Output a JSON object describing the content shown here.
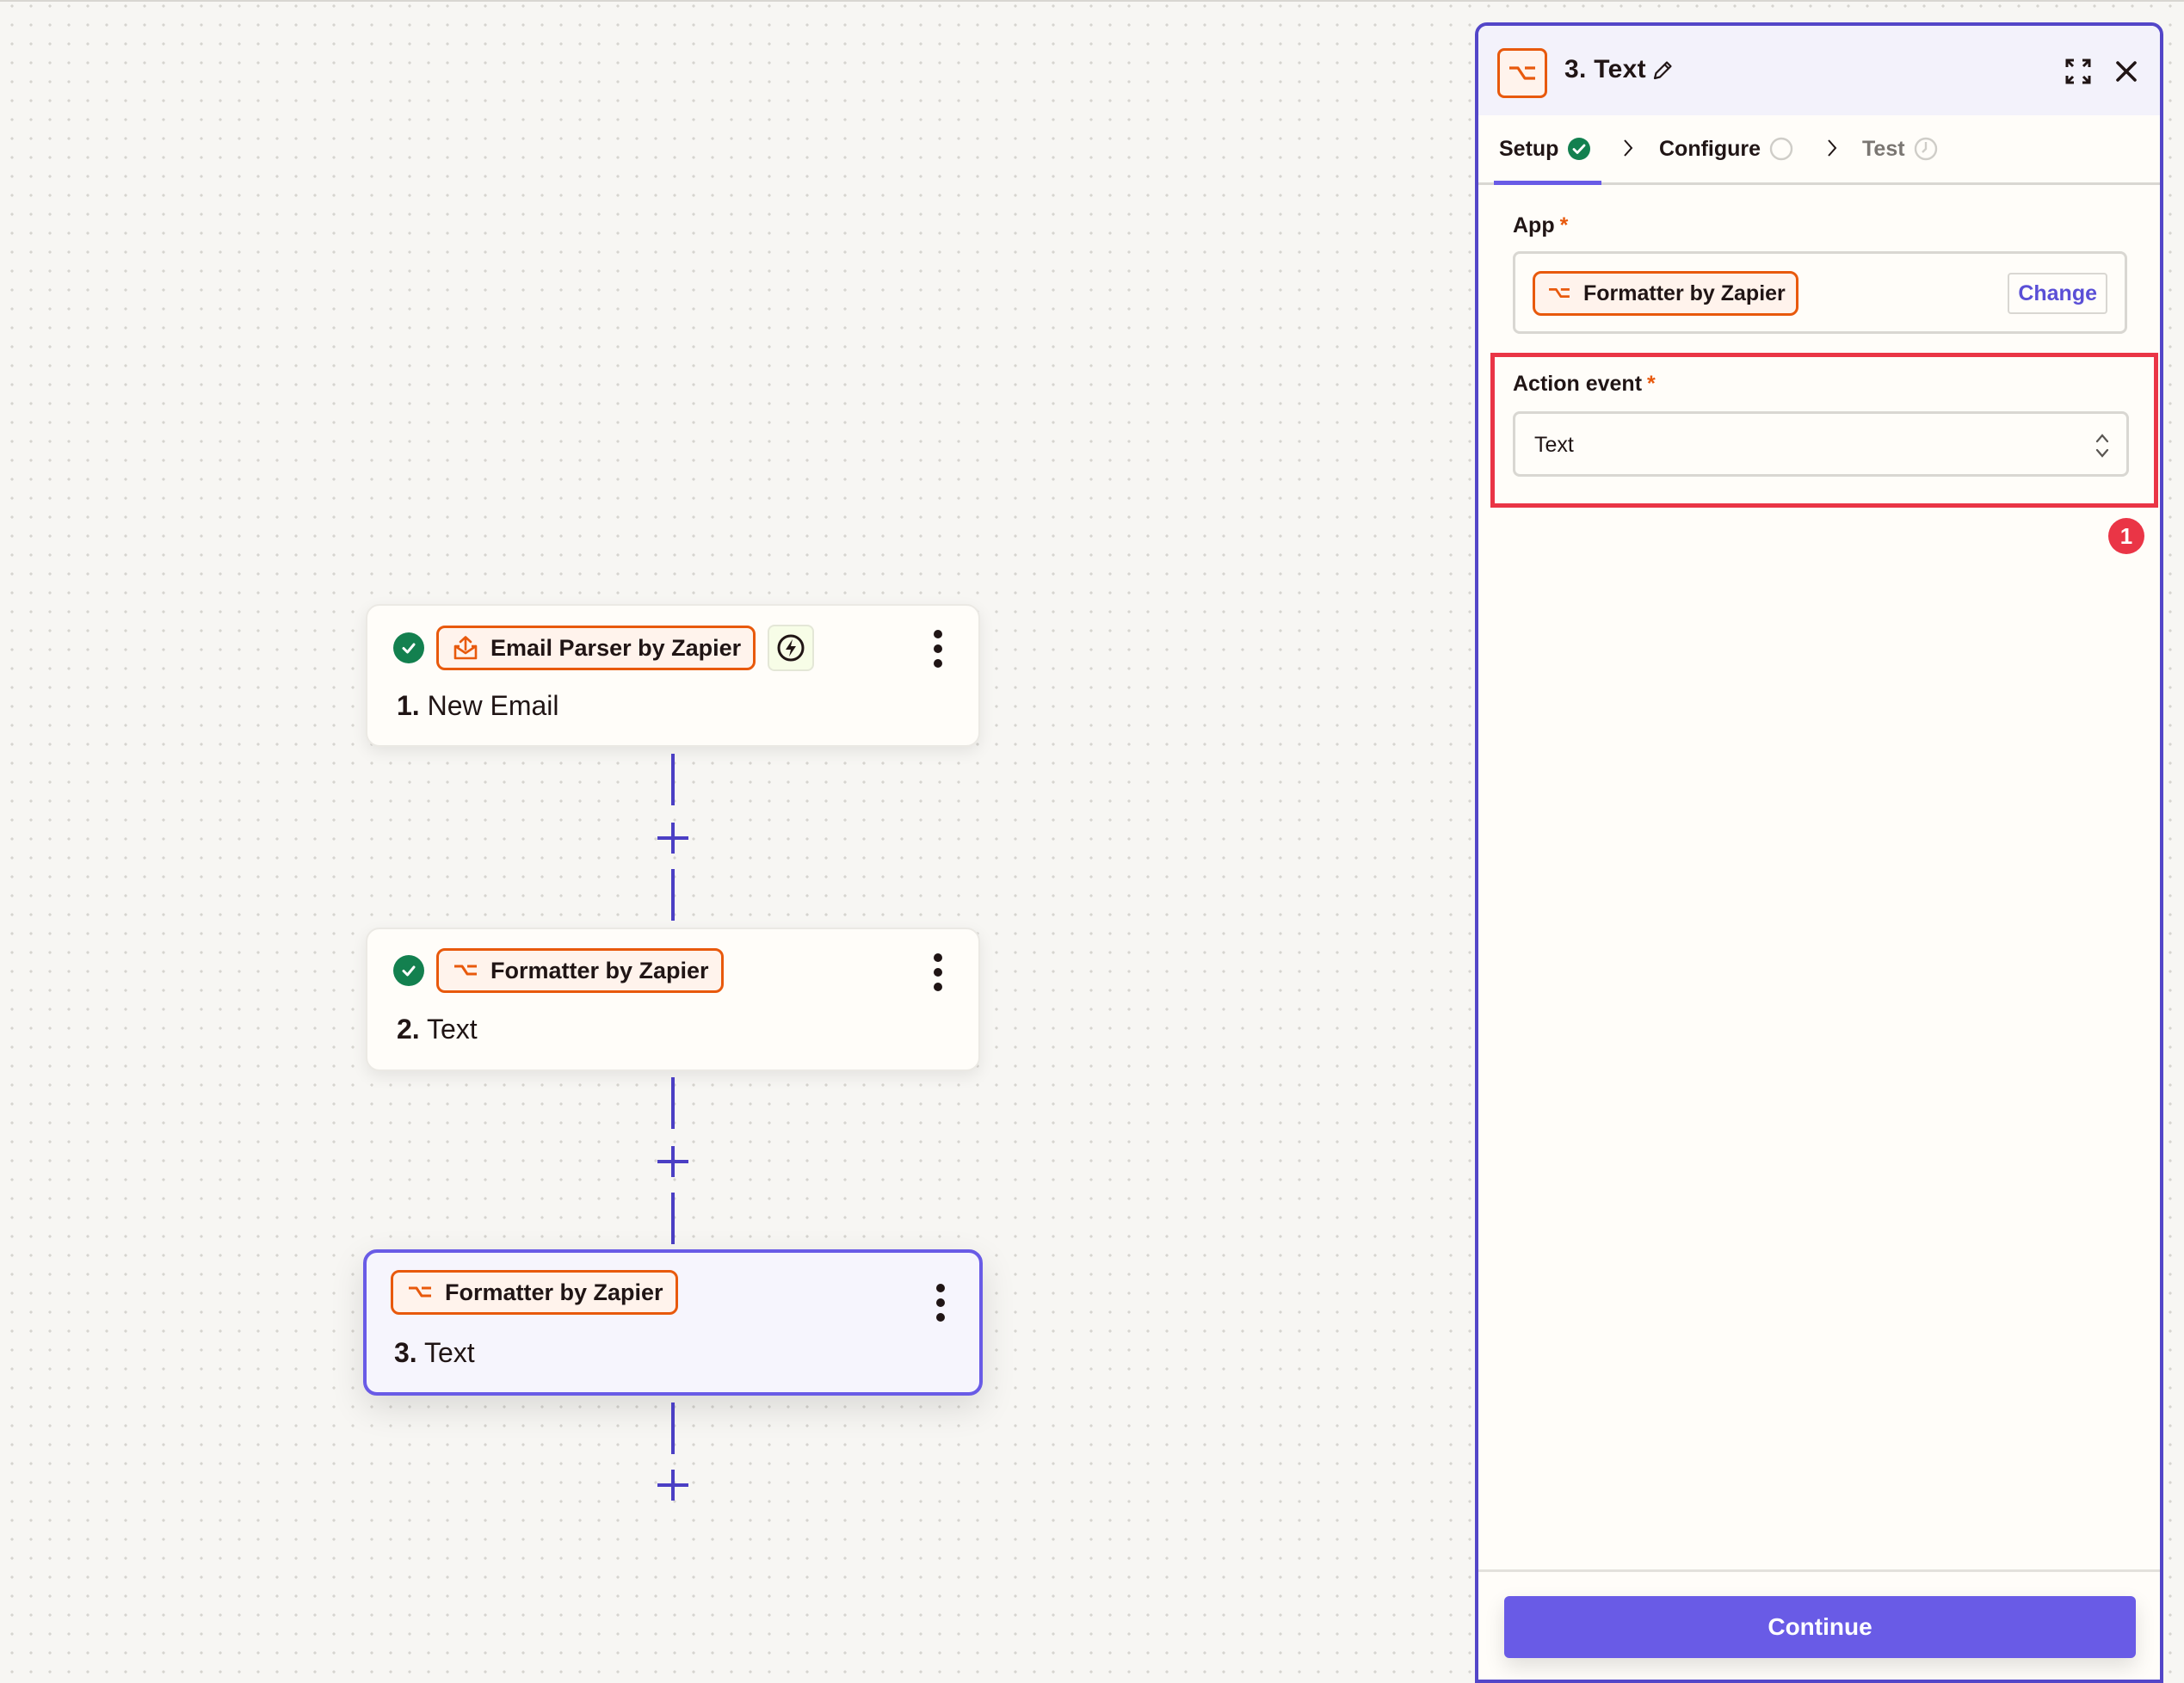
{
  "canvas": {
    "steps": [
      {
        "number": "1.",
        "name": "New Email",
        "app": "Email Parser by Zapier",
        "status": "complete",
        "is_trigger": true
      },
      {
        "number": "2.",
        "name": "Text",
        "app": "Formatter by Zapier",
        "status": "complete",
        "is_trigger": false
      },
      {
        "number": "3.",
        "name": "Text",
        "app": "Formatter by Zapier",
        "status": "selected",
        "is_trigger": false
      }
    ]
  },
  "panel": {
    "title": "3. Text",
    "tabs": [
      {
        "label": "Setup",
        "state": "complete"
      },
      {
        "label": "Configure",
        "state": "pending"
      },
      {
        "label": "Test",
        "state": "disabled"
      }
    ],
    "app_field": {
      "label": "App",
      "required_mark": "*",
      "value": "Formatter by Zapier",
      "change_label": "Change"
    },
    "action_event_field": {
      "label": "Action event",
      "required_mark": "*",
      "value": "Text"
    },
    "annotation_badge": "1",
    "continue_label": "Continue"
  },
  "colors": {
    "accent": "#695be6",
    "app_orange": "#e8590c",
    "success": "#13804f",
    "highlight_red": "#ea3546"
  }
}
